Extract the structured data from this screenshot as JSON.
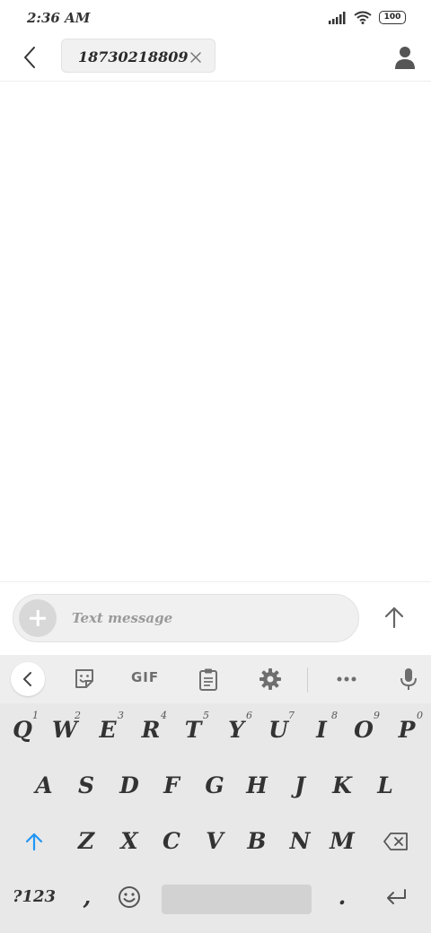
{
  "status": {
    "time": "2:36 AM",
    "battery": "100"
  },
  "header": {
    "recipient": "18730218809"
  },
  "composer": {
    "placeholder": "Text message"
  },
  "toolbar": {
    "gif_label": "GIF"
  },
  "keyboard": {
    "row1": [
      {
        "label": "Q",
        "hint": "1"
      },
      {
        "label": "W",
        "hint": "2"
      },
      {
        "label": "E",
        "hint": "3"
      },
      {
        "label": "R",
        "hint": "4"
      },
      {
        "label": "T",
        "hint": "5"
      },
      {
        "label": "Y",
        "hint": "6"
      },
      {
        "label": "U",
        "hint": "7"
      },
      {
        "label": "I",
        "hint": "8"
      },
      {
        "label": "O",
        "hint": "9"
      },
      {
        "label": "P",
        "hint": "0"
      }
    ],
    "row2": [
      "A",
      "S",
      "D",
      "F",
      "G",
      "H",
      "J",
      "K",
      "L"
    ],
    "row3": [
      "Z",
      "X",
      "C",
      "V",
      "B",
      "N",
      "M"
    ],
    "symbols_label": "?123",
    "comma_label": ",",
    "period_label": "."
  },
  "colors": {
    "shift_accent": "#2196f3",
    "icon_gray": "#6e6e6e"
  }
}
